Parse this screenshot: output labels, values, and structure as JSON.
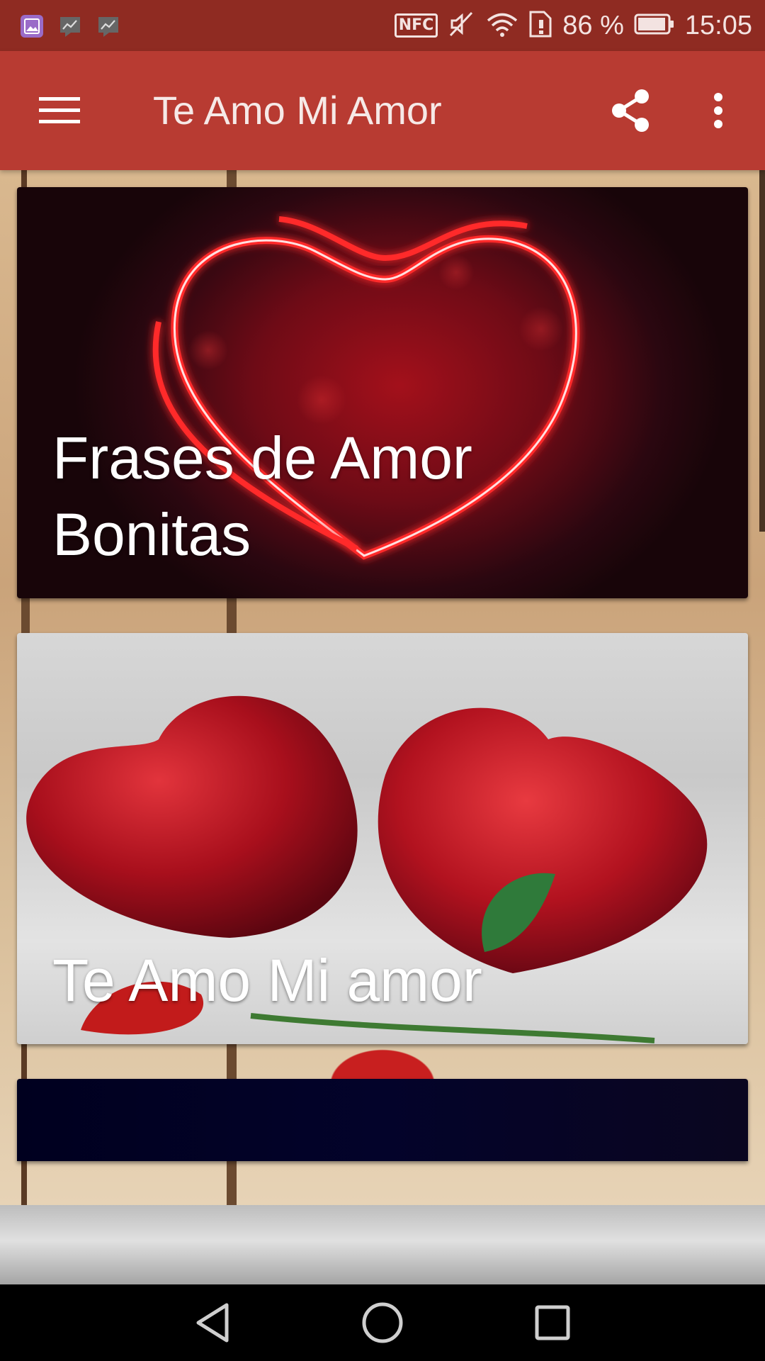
{
  "status_bar": {
    "nfc_label": "NFC",
    "battery": "86 %",
    "time": "15:05",
    "icons": [
      "gallery-notification-icon",
      "chart-notification-icon",
      "chart-notification-icon",
      "nfc-icon",
      "mute-icon",
      "wifi-icon",
      "sim-icon",
      "battery-icon"
    ]
  },
  "app_bar": {
    "title": "Te Amo Mi Amor",
    "menu_icon": "hamburger-menu-icon",
    "share_icon": "share-icon",
    "more_icon": "more-vertical-icon",
    "color": "#b83b32"
  },
  "cards": [
    {
      "title_line1": "Frases de Amor",
      "title_line2": "Bonitas"
    },
    {
      "title_line1": "Te Amo Mi amor"
    },
    {
      "title_line1": ""
    }
  ],
  "nav_bar": {
    "back_icon": "back-triangle-icon",
    "home_icon": "home-circle-icon",
    "recents_icon": "recents-square-icon"
  },
  "colors": {
    "status_bar": "#8f2b22",
    "app_bar": "#b83b32",
    "card_text": "#ffffff"
  }
}
